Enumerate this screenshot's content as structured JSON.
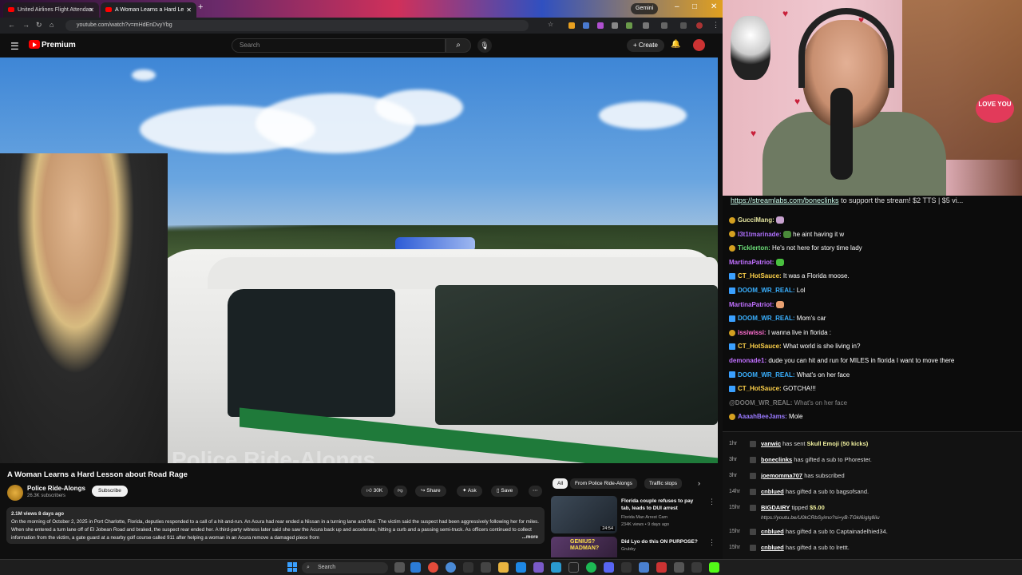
{
  "browser": {
    "tabs": [
      {
        "label": "United Airlines Flight Attendan"
      },
      {
        "label": "A Woman Learns a Hard Le"
      }
    ],
    "gemini_label": "Gemini",
    "url": "youtube.com/watch?v=mHdEnDvyYbg"
  },
  "youtube": {
    "logo_text": "Premium",
    "search_placeholder": "Search",
    "create_label": "Create"
  },
  "video": {
    "watermark": "Police Ride-Alongs",
    "title": "A Woman Learns a Hard Lesson about Road Rage",
    "channel": "Police Ride-Alongs",
    "subscribers": "26.3K subscribers",
    "subscribe_label": "Subscribe",
    "likes": "30K",
    "share_label": "Share",
    "ask_label": "Ask",
    "save_label": "Save",
    "meta": "2.1M views  8 days ago",
    "description": "On the morning of October 2, 2025 in Port Charlotte, Florida, deputies responded to a call of a hit-and-run. An Acura had rear ended a Nissan in a turning lane and fled. The victim said the suspect had been aggressively following her for miles. When she entered a turn lane off of El Jobean Road and braked, the suspect rear ended her. A third-party witness later said she saw the Acura back up and accelerate, hitting a curb and a passing semi-truck. As officers continued to collect information from the victim, a gate guard at a nearby golf course called 911 after helping a woman in an Acura remove a damaged piece from",
    "more_label": "...more"
  },
  "recommendations": {
    "chips": [
      "All",
      "From Police Ride-Alongs",
      "Traffic stops"
    ],
    "items": [
      {
        "title": "Florida couple refuses to pay tab, leads to DUI arrest",
        "channel": "Florida Man Arrest Cam",
        "stats": "234K views • 9 days ago",
        "duration": "24:54"
      },
      {
        "title": "Did Lyo do this ON PURPOSE?",
        "channel": "Grubby",
        "stats": "",
        "duration": "",
        "thumb_text": "GENIUS? MADMAN?"
      }
    ]
  },
  "stream": {
    "love_text": "LOVE YOU",
    "banner_link": "https://streamlabs.com/boneclinks",
    "banner_text": " to support the stream! $2 TTS | $5 vi..."
  },
  "chat": [
    {
      "user": "GucciMang:",
      "text": "",
      "color": "#e6e6a0",
      "badge": "gold",
      "emote": "#c9a3d0"
    },
    {
      "user": "l3t1tmarinade:",
      "text": "he aint having it w",
      "color": "#b070ff",
      "badge": "gold",
      "emote": "#4a8a3a"
    },
    {
      "user": "Ticklerton:",
      "text": "He's not here for story time lady",
      "color": "#6ee07a",
      "badge": "gold2",
      "emote": ""
    },
    {
      "user": "MartinaPatriot:",
      "text": "",
      "color": "#c070ff",
      "badge": "",
      "emote": "#4ac040"
    },
    {
      "user": "CT_HotSauce:",
      "text": "It was a Florida moose.",
      "color": "#ffd24a",
      "badge": "blue",
      "emote": ""
    },
    {
      "user": "DOOM_WR_REAL:",
      "text": "Lol",
      "color": "#3ab0ff",
      "badge": "blue",
      "emote": ""
    },
    {
      "user": "MartinaPatriot:",
      "text": "",
      "color": "#c070ff",
      "badge": "",
      "emote": "#e8a070"
    },
    {
      "user": "DOOM_WR_REAL:",
      "text": "Mom's car",
      "color": "#3ab0ff",
      "badge": "blue",
      "emote": ""
    },
    {
      "user": "issiwissi:",
      "text": "I wanna live in florida :",
      "color": "#ff6fd0",
      "badge": "gold",
      "emote": ""
    },
    {
      "user": "CT_HotSauce:",
      "text": "What world is she living in?",
      "color": "#ffd24a",
      "badge": "blue",
      "emote": ""
    },
    {
      "user": "demonade1:",
      "text": "dude you can hit and run for MILES in florida I want to move there",
      "color": "#c070ff",
      "badge": "",
      "emote": ""
    },
    {
      "user": "DOOM_WR_REAL:",
      "text": "What's on her face",
      "color": "#3ab0ff",
      "badge": "blue",
      "emote": ""
    },
    {
      "user": "CT_HotSauce:",
      "text": "GOTCHA!!!",
      "color": "#ffd24a",
      "badge": "blue",
      "emote": ""
    },
    {
      "user": "@DOOM_WR_REAL:",
      "text": "What's on her face",
      "color": "#777",
      "badge": "",
      "emote": "",
      "faded": true
    },
    {
      "user": "AaaahBeeJams:",
      "text": "Mole",
      "color": "#9a7aff",
      "badge": "gold",
      "emote": ""
    }
  ],
  "events": [
    {
      "time": "1hr",
      "name": "vanwic",
      "text": " has sent ",
      "extra": "Skull Emoji (50 kicks)"
    },
    {
      "time": "3hr",
      "name": "boneclinks",
      "text": " has gifted a sub to Phorester.",
      "extra": ""
    },
    {
      "time": "3hr",
      "name": "joemomma707",
      "text": " has subscribed",
      "extra": ""
    },
    {
      "time": "14hr",
      "name": "cnblued",
      "text": " has gifted a sub to bagsofsand.",
      "extra": ""
    },
    {
      "time": "15hr",
      "name": "BIGDAIRY",
      "text": " tipped ",
      "extra": "$5.00",
      "sub": "https://youtu.be/U0kCRbSyimo?si=yB-TGkI6iglg8iiu"
    },
    {
      "time": "15hr",
      "name": "cnblued",
      "text": " has gifted a sub to Captainadelhied34.",
      "extra": ""
    },
    {
      "time": "15hr",
      "name": "cnblued",
      "text": " has gifted a sub to lrettt.",
      "extra": ""
    },
    {
      "time": "15hr",
      "name": "cnblued",
      "text": " has gifted a sub to MF_TWILLIS.",
      "extra": ""
    }
  ],
  "taskbar": {
    "search_label": "Search"
  }
}
